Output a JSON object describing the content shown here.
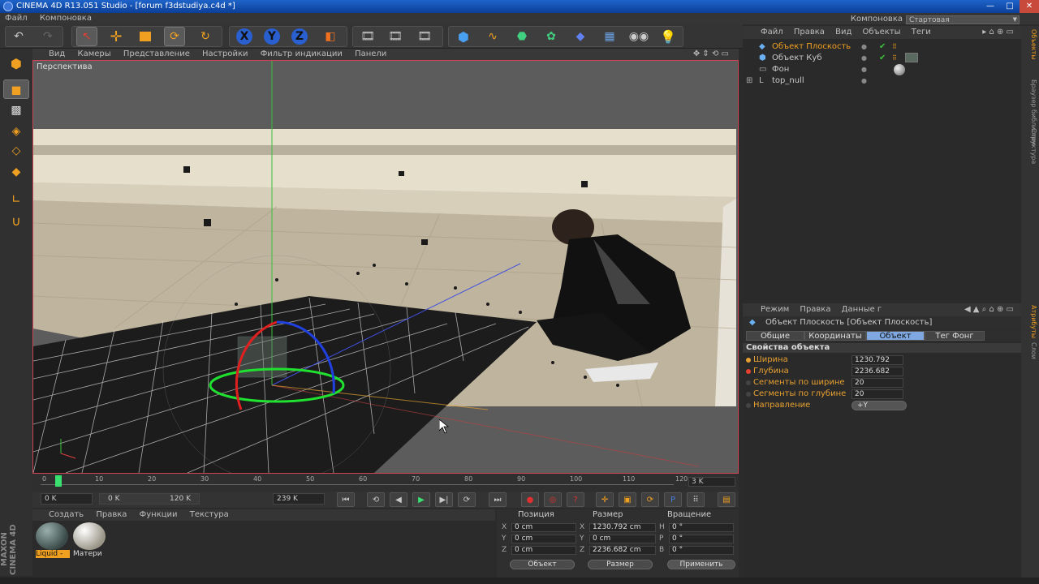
{
  "titlebar": {
    "title": "CINEMA 4D R13.051 Studio - [forum f3dstudiya.c4d *]"
  },
  "menubar": {
    "items": [
      "Файл",
      "Компоновка"
    ],
    "layout_label": "Компоновка",
    "layout_value": "Стартовая"
  },
  "viewport": {
    "menu": [
      "Вид",
      "Камеры",
      "Представление",
      "Настройки",
      "Фильтр индикации",
      "Панели"
    ],
    "label": "Перспектива"
  },
  "timeline": {
    "ticks": [
      "0",
      "10",
      "20",
      "30",
      "40",
      "50",
      "60",
      "70",
      "80",
      "90",
      "100",
      "110",
      "120"
    ],
    "end_frame": "3 K",
    "current_frame": "0 K",
    "range_start": "0 K",
    "range_end": "120 K",
    "max_frame": "239 K"
  },
  "materials": {
    "menu": [
      "Создать",
      "Правка",
      "Функции",
      "Текстура"
    ],
    "items": [
      {
        "label": "Liquid -",
        "color": "#4a5a58"
      },
      {
        "label": "Матери",
        "color": "#d8d4c8"
      }
    ]
  },
  "maxon_text": "MAXON CINEMA 4D",
  "coords": {
    "headers": {
      "position": "Позиция",
      "size": "Размер",
      "rotation": "Вращение"
    },
    "rows": [
      {
        "ax1": "X",
        "pos": "0 cm",
        "ax2": "X",
        "size": "1230.792 cm",
        "ax3": "H",
        "rot": "0 °"
      },
      {
        "ax1": "Y",
        "pos": "0 cm",
        "ax2": "Y",
        "size": "0 cm",
        "ax3": "P",
        "rot": "0 °"
      },
      {
        "ax1": "Z",
        "pos": "0 cm",
        "ax2": "Z",
        "size": "2236.682 cm",
        "ax3": "B",
        "rot": "0 °"
      }
    ],
    "mode_object": "Объект",
    "mode_size": "Размер",
    "apply": "Применить"
  },
  "objects": {
    "menu": [
      "Файл",
      "Правка",
      "Вид",
      "Объекты",
      "Теги"
    ],
    "items": [
      {
        "name": "Объект Плоскость",
        "selected": true
      },
      {
        "name": "Объект Куб",
        "selected": false
      },
      {
        "name": "Фон",
        "selected": false
      },
      {
        "name": "top_null",
        "selected": false
      }
    ]
  },
  "sidetabs": [
    "Объекты",
    "Браузер библиотек",
    "Структура",
    "Атрибуты",
    "Слои"
  ],
  "attributes": {
    "menu": [
      "Режим",
      "Правка",
      "Данные г"
    ],
    "title": "Объект Плоскость [Объект Плоскость]",
    "tabs": [
      "Общие",
      "Координаты",
      "Объект",
      "Тег Фонг"
    ],
    "active_tab": "Объект",
    "section": "Свойства объекта",
    "props": [
      {
        "label": "Ширина",
        "value": "1230.792",
        "dot": "#e8a030"
      },
      {
        "label": "Глубина",
        "value": "2236.682",
        "dot": "#e84030"
      },
      {
        "label": "Сегменты по ширине",
        "value": "20",
        "dot": "#444"
      },
      {
        "label": "Сегменты по глубине",
        "value": "20",
        "dot": "#444"
      },
      {
        "label": "Направление",
        "value": "+Y",
        "dot": "#444"
      }
    ]
  }
}
